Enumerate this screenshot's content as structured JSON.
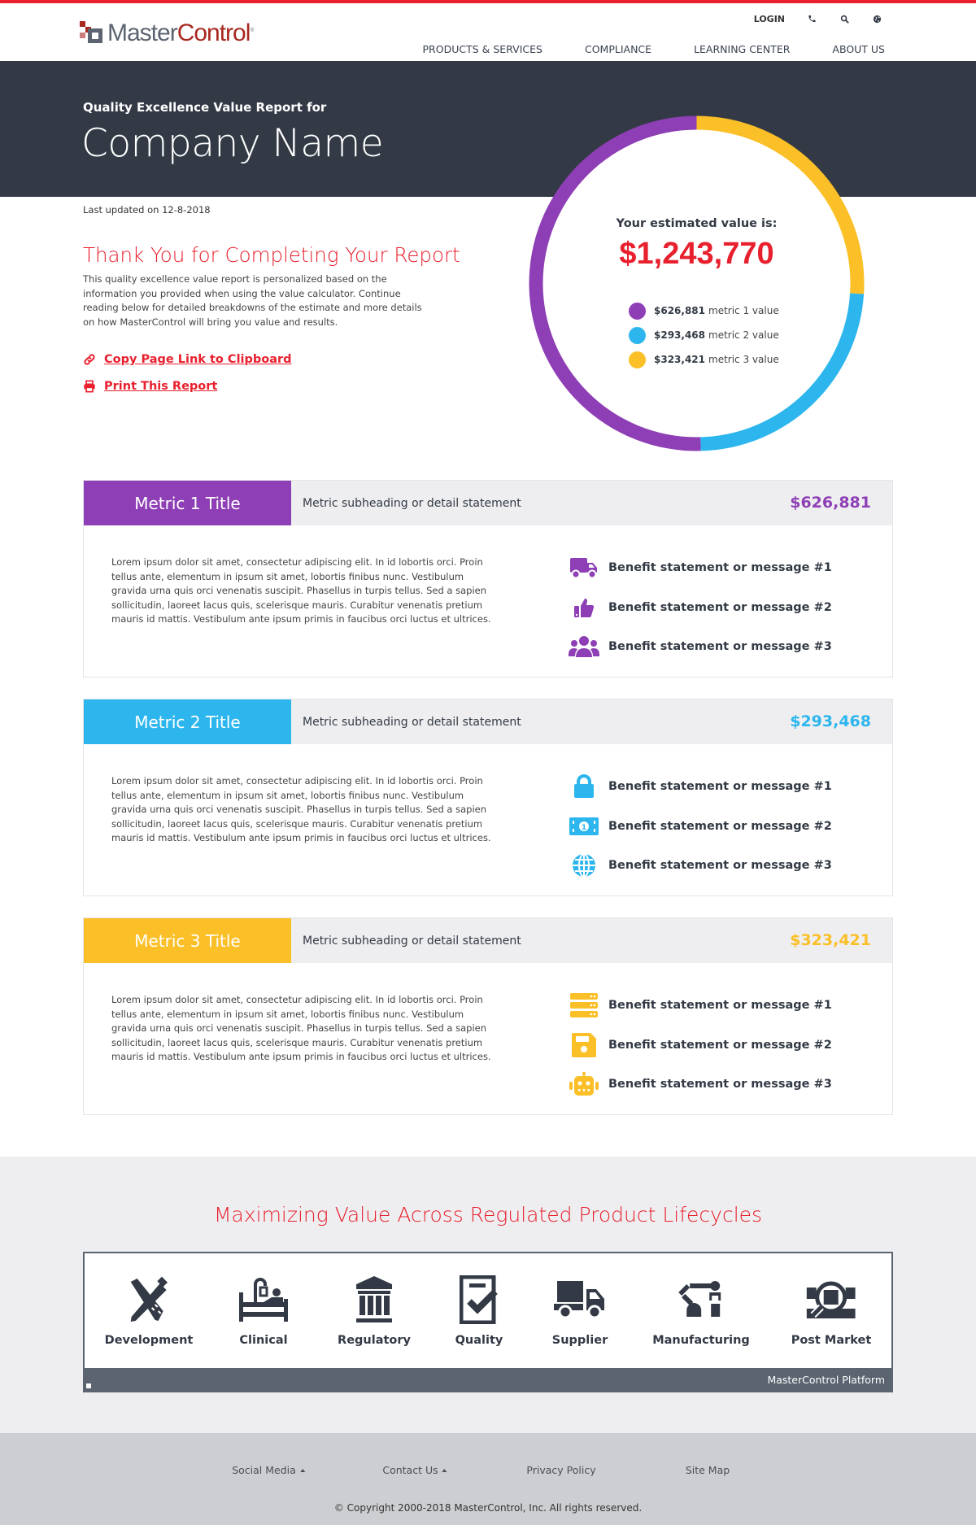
{
  "header": {
    "logo": {
      "part1": "Master",
      "part2": "Control",
      "tm": "®"
    },
    "utility": {
      "login": "LOGIN",
      "icons": [
        "phone-icon",
        "search-icon",
        "globe-icon"
      ]
    },
    "nav": [
      "PRODUCTS & SERVICES",
      "COMPLIANCE",
      "LEARNING CENTER",
      "ABOUT US"
    ]
  },
  "hero": {
    "subtitle": "Quality Excellence Value Report for",
    "title": "Company Name"
  },
  "intro": {
    "updated": "Last updated on 12-8-2018",
    "heading": "Thank You for Completing Your Report",
    "body": "This quality excellence value report is personalized based on the information you provided when using the value calculator. Continue reading below for detailed breakdowns of the estimate and more details on how MasterControl will bring you value and results.",
    "copy_link": "Copy Page Link to Clipboard",
    "print_link": "Print This Report"
  },
  "colors": {
    "brand_red": "#e8202e",
    "metric1": "#8e3fb5",
    "metric2": "#2db6ee",
    "metric3": "#fbbf28",
    "dark": "#333a46"
  },
  "summary": {
    "label": "Your estimated value is:",
    "total": "$1,243,770",
    "legend": [
      {
        "value": "$626,881",
        "label": "metric 1 value"
      },
      {
        "value": "$293,468",
        "label": "metric 2 value"
      },
      {
        "value": "$323,421",
        "label": "metric 3 value"
      }
    ]
  },
  "chart_data": {
    "type": "pie",
    "variant": "donut",
    "title": "Your estimated value is:",
    "total": 1243770,
    "start": "top, clockwise",
    "slices": [
      {
        "name": "metric 3 value",
        "value": 323421,
        "color": "#fbbf28"
      },
      {
        "name": "metric 2 value",
        "value": 293468,
        "color": "#2db6ee"
      },
      {
        "name": "metric 1 value",
        "value": 626881,
        "color": "#8e3fb5"
      }
    ]
  },
  "metrics": [
    {
      "title": "Metric 1 Title",
      "subheading": "Metric subheading or detail statement",
      "value": "$626,881",
      "body": "Lorem ipsum dolor sit amet, consectetur adipiscing elit. In id lobortis orci. Proin tellus ante, elementum in ipsum sit amet, lobortis finibus nunc. Vestibulum gravida urna quis orci venenatis suscipit. Phasellus in turpis tellus. Sed a sapien sollicitudin, laoreet lacus quis, scelerisque mauris. Curabitur venenatis pretium mauris id mattis. Vestibulum ante ipsum primis in faucibus orci luctus et ultrices.",
      "benefits": [
        {
          "icon": "truck-icon",
          "text": "Benefit statement or message #1"
        },
        {
          "icon": "thumbs-up-icon",
          "text": "Benefit statement or message #2"
        },
        {
          "icon": "users-icon",
          "text": "Benefit statement or message #3"
        }
      ]
    },
    {
      "title": "Metric 2 Title",
      "subheading": "Metric subheading or detail statement",
      "value": "$293,468",
      "body": "Lorem ipsum dolor sit amet, consectetur adipiscing elit. In id lobortis orci. Proin tellus ante, elementum in ipsum sit amet, lobortis finibus nunc. Vestibulum gravida urna quis orci venenatis suscipit. Phasellus in turpis tellus. Sed a sapien sollicitudin, laoreet lacus quis, scelerisque mauris. Curabitur venenatis pretium mauris id mattis. Vestibulum ante ipsum primis in faucibus orci luctus et ultrices.",
      "benefits": [
        {
          "icon": "lock-icon",
          "text": "Benefit statement or message #1"
        },
        {
          "icon": "money-bill-icon",
          "text": "Benefit statement or message #2"
        },
        {
          "icon": "globe-icon",
          "text": "Benefit statement or message #3"
        }
      ]
    },
    {
      "title": "Metric 3 Title",
      "subheading": "Metric subheading or detail statement",
      "value": "$323,421",
      "body": "Lorem ipsum dolor sit amet, consectetur adipiscing elit. In id lobortis orci. Proin tellus ante, elementum in ipsum sit amet, lobortis finibus nunc. Vestibulum gravida urna quis orci venenatis suscipit. Phasellus in turpis tellus. Sed a sapien sollicitudin, laoreet lacus quis, scelerisque mauris. Curabitur venenatis pretium mauris id mattis. Vestibulum ante ipsum primis in faucibus orci luctus et ultrices.",
      "benefits": [
        {
          "icon": "server-icon",
          "text": "Benefit statement or message #1"
        },
        {
          "icon": "floppy-disk-icon",
          "text": "Benefit statement or message #2"
        },
        {
          "icon": "robot-icon",
          "text": "Benefit statement or message #3"
        }
      ]
    }
  ],
  "lifecycle": {
    "title": "Maximizing Value Across Regulated Product Lifecycles",
    "items": [
      {
        "label": "Development",
        "icon": "pencil-ruler-icon"
      },
      {
        "label": "Clinical",
        "icon": "hospital-bed-icon"
      },
      {
        "label": "Regulatory",
        "icon": "government-building-icon"
      },
      {
        "label": "Quality",
        "icon": "clipboard-check-icon"
      },
      {
        "label": "Supplier",
        "icon": "truck-icon"
      },
      {
        "label": "Manufacturing",
        "icon": "robot-arm-icon"
      },
      {
        "label": "Post Market",
        "icon": "magnifier-box-icon"
      }
    ],
    "platform": "MasterControl Platform"
  },
  "footer": {
    "links": [
      {
        "label": "Social Media",
        "dropdown": true
      },
      {
        "label": "Contact Us",
        "dropdown": true
      },
      {
        "label": "Privacy Policy",
        "dropdown": false
      },
      {
        "label": "Site Map",
        "dropdown": false
      }
    ],
    "copyright": "© Copyright 2000-2018 MasterControl, Inc. All rights reserved."
  }
}
